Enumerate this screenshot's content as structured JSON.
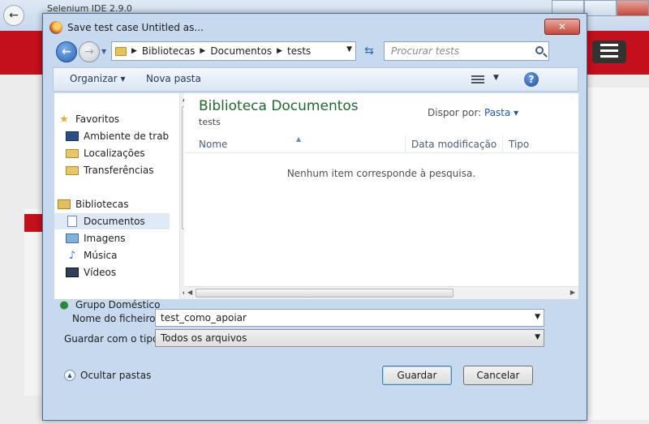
{
  "background": {
    "tab_label": "Selenium IDE 2.9.0"
  },
  "dialog": {
    "title": "Save test case Untitled as...",
    "close_label": "✕",
    "breadcrumb": [
      "Bibliotecas",
      "Documentos",
      "tests"
    ],
    "search_placeholder": "Procurar tests",
    "toolbar": {
      "organize_label": "Organizar ▾",
      "new_folder_label": "Nova pasta"
    },
    "nav_items": [
      {
        "label": "Favoritos",
        "icon": "star-icon"
      },
      {
        "label": "Ambiente de trab",
        "icon": "desktop-icon"
      },
      {
        "label": "Localizações",
        "icon": "location-folder-icon"
      },
      {
        "label": "Transferências",
        "icon": "downloads-icon"
      },
      {
        "label": "Bibliotecas",
        "icon": "libraries-icon"
      },
      {
        "label": "Documentos",
        "icon": "documents-icon"
      },
      {
        "label": "Imagens",
        "icon": "images-icon"
      },
      {
        "label": "Música",
        "icon": "music-icon"
      },
      {
        "label": "Vídeos",
        "icon": "videos-icon"
      },
      {
        "label": "Grupo Doméstico",
        "icon": "homegroup-icon"
      }
    ],
    "library": {
      "title": "Biblioteca Documentos",
      "subtitle": "tests",
      "arrange_label": "Dispor por:",
      "arrange_value": "Pasta ▾"
    },
    "columns": {
      "name": "Nome",
      "date": "Data modificação",
      "type": "Tipo"
    },
    "empty_message": "Nenhum item corresponde à pesquisa.",
    "form": {
      "filename_label": "Nome do ficheiro:",
      "filename_value": "test_como_apoiar",
      "filetype_label": "Guardar com o tipo:",
      "filetype_value": "Todos os arquivos"
    },
    "hide_folders_label": "Ocultar pastas",
    "save_label": "Guardar",
    "cancel_label": "Cancelar"
  },
  "colors": {
    "brand_red": "#c40f1c",
    "library_title": "#1e6a2c",
    "link_blue": "#1e5aa8"
  }
}
